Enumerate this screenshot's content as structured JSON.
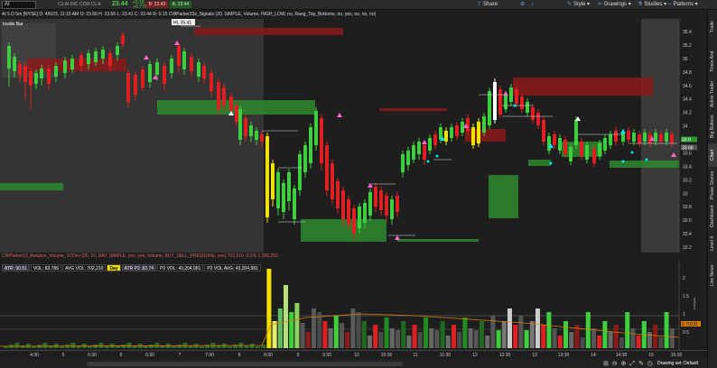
{
  "topbar": {
    "symbol": "AI",
    "company": "C3.AI INC COM CL A",
    "last": "23.44",
    "change_line1": "+0.18",
    "change_line2": "+0.77%",
    "bid": "B: 23.43",
    "ask": "A: 23.44",
    "buttons": {
      "share": "Share",
      "style": "Style",
      "drawings": "Drawings",
      "studies": "Studies",
      "patterns": "Patterns"
    }
  },
  "infobar": {
    "text": "AI 5 D 5m [NYSE]   D: 4/6/23, 11:15 AM   O: 23.56   H: 23.56   L: 23.41   C: 23.44   R: 0.15   CWParker23s_Signals (20, SIMPLE, Volume, HIGH_LOW, no, Rang_Top_Bottome, no, yes, no, no, no)"
  },
  "labels": {
    "inside_bar": "Inside Bar",
    "tooltip": "HL 35.41"
  },
  "lower_study": {
    "title": "CWParker23_Relative_Volume_STDev (20, 16, DAY, SIMPLE, yes, yes, Volume, BUY_SELL_PRESSURE, yes)  702,210  -2,1%  1,356,252",
    "stats": [
      {
        "text": "ATR: 90.51",
        "cls": "atr"
      },
      {
        "text": "VOL: 83.786",
        "cls": ""
      },
      {
        "text": "AVG VOL: 702,210",
        "cls": ""
      },
      {
        "text": "Day",
        "cls": "day"
      },
      {
        "text": "ATR P2: 82.74",
        "cls": "atr"
      },
      {
        "text": "P2 VOL: 43,204,981",
        "cls": ""
      },
      {
        "text": "P2 VOL AVG: 43,204,981",
        "cls": ""
      }
    ]
  },
  "price_axis": {
    "ticks": [
      "35.4",
      "35.2",
      "35",
      "34.8",
      "34.6",
      "34.4",
      "34.2",
      "34",
      "33.8",
      "33.6",
      "33.4",
      "33.2",
      "33",
      "32.8",
      "32.6",
      "32.4",
      "32.2"
    ],
    "badges": [
      {
        "text": "33.8",
        "bg": "#2a9a2a"
      },
      {
        "text": "33.68",
        "bg": "#555555"
      }
    ]
  },
  "volume_axis": {
    "ticks": [
      "2",
      "1.5",
      "1",
      "0.5"
    ],
    "unit_label": "millions",
    "badge": "0.70231",
    "badge_bg": "#e08000"
  },
  "time_axis": {
    "labels": [
      "4:30",
      "5",
      "5:30",
      "6",
      "6:30",
      "7",
      "7:30",
      "8",
      "8:30",
      "9",
      "9:30",
      "10",
      "10:30",
      "11",
      "11:30",
      "12",
      "12:30",
      "13",
      "13:30",
      "14",
      "14:30",
      "15",
      "15:30"
    ]
  },
  "bottombar": {
    "drawing_set": "Drawing set: Default",
    "icons": "⊞ ⊖ ⊕ ⤢ ✎ ◷"
  },
  "sidebar_tabs": [
    "Trade",
    "Times And Sales",
    "Active Trader",
    "Big Buttons",
    "Chart",
    "Phase Scores",
    "Dashboard",
    "Level II",
    "Live News"
  ],
  "sidebar_active": "Chart",
  "colors": {
    "up": "#3ecf3e",
    "down": "#e02020",
    "neutral": "#f0e000",
    "zone_red": "#8b1a1a",
    "zone_green": "#2e8b2e",
    "bg": "#1e1e1e",
    "premarket": "#343434"
  }
}
